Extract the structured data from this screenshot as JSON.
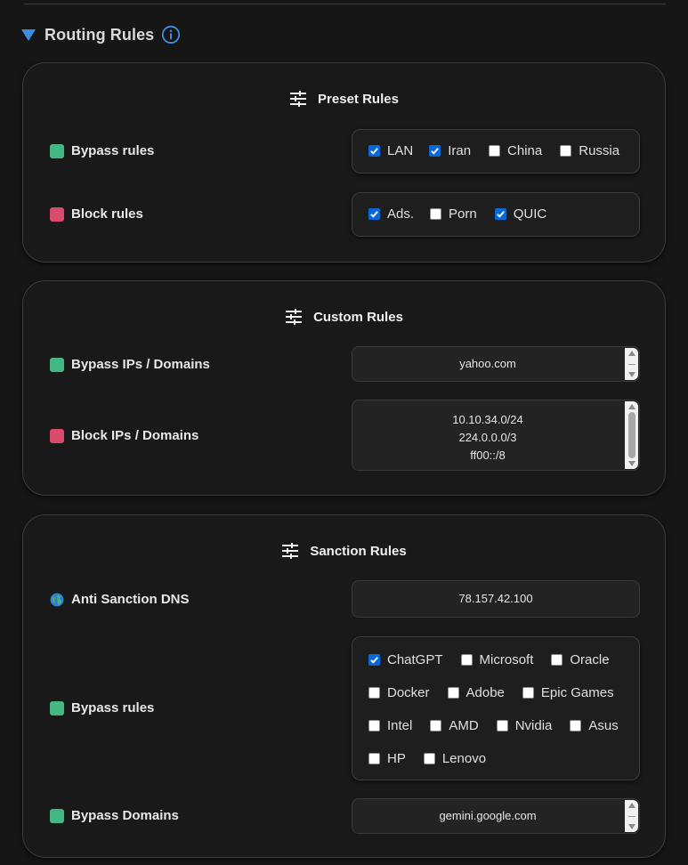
{
  "section": {
    "title": "Routing Rules",
    "info_icon": "info-circle-icon",
    "accent": "#3a8ee6"
  },
  "colors": {
    "bypass": "#43b883",
    "block": "#d94b6a",
    "checkbox_on": "#0a67d6"
  },
  "preset": {
    "title": "Preset Rules",
    "bypass_label": "Bypass rules",
    "block_label": "Block rules",
    "bypass_options": [
      {
        "label": "LAN",
        "checked": true
      },
      {
        "label": "Iran",
        "checked": true
      },
      {
        "label": "China",
        "checked": false
      },
      {
        "label": "Russia",
        "checked": false
      }
    ],
    "block_options": [
      {
        "label": "Ads.",
        "checked": true
      },
      {
        "label": "Porn",
        "checked": false
      },
      {
        "label": "QUIC",
        "checked": true
      }
    ]
  },
  "custom": {
    "title": "Custom Rules",
    "bypass_label": "Bypass IPs / Domains",
    "block_label": "Block IPs / Domains",
    "bypass_value": "yahoo.com",
    "block_values": [
      "10.10.34.0/24",
      "224.0.0.0/3",
      "ff00::/8"
    ]
  },
  "sanction": {
    "title": "Sanction Rules",
    "dns_label": "Anti Sanction DNS",
    "dns_icon": "globe-icon",
    "dns_value": "78.157.42.100",
    "bypass_label": "Bypass rules",
    "bypass_options": [
      [
        {
          "label": "ChatGPT",
          "checked": true
        },
        {
          "label": "Microsoft",
          "checked": false
        },
        {
          "label": "Oracle",
          "checked": false
        }
      ],
      [
        {
          "label": "Docker",
          "checked": false
        },
        {
          "label": "Adobe",
          "checked": false
        },
        {
          "label": "Epic Games",
          "checked": false
        }
      ],
      [
        {
          "label": "Intel",
          "checked": false
        },
        {
          "label": "AMD",
          "checked": false
        },
        {
          "label": "Nvidia",
          "checked": false
        },
        {
          "label": "Asus",
          "checked": false
        }
      ],
      [
        {
          "label": "HP",
          "checked": false
        },
        {
          "label": "Lenovo",
          "checked": false
        }
      ]
    ],
    "domains_label": "Bypass Domains",
    "domains_value": "gemini.google.com"
  }
}
